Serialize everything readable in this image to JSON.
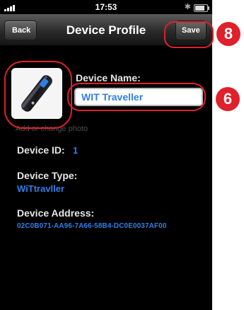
{
  "status_bar": {
    "time": "17:53",
    "carrier_icon": "signal-bars-icon",
    "bluetooth_icon": "bluetooth-icon",
    "battery_level": 0.8
  },
  "nav": {
    "title": "Device Profile",
    "back_label": "Back",
    "save_label": "Save"
  },
  "photo": {
    "icon": "usb-stick-device-icon",
    "change_label": "Add or change photo"
  },
  "device": {
    "name_label": "Device Name:",
    "name_value": "WIT Traveller",
    "id_label": "Device ID:",
    "id_value": "1",
    "type_label": "Device Type:",
    "type_value": "WiTtravller",
    "address_label": "Device Address:",
    "address_value": "02C0B071-AA96-7A66-58B4-DC0E0037AF00"
  },
  "annotations": {
    "save_number": "8",
    "name_number": "6"
  },
  "colors": {
    "accent_blue": "#2f7fe6",
    "annotation_red": "#e0202a",
    "background": "#000000"
  }
}
